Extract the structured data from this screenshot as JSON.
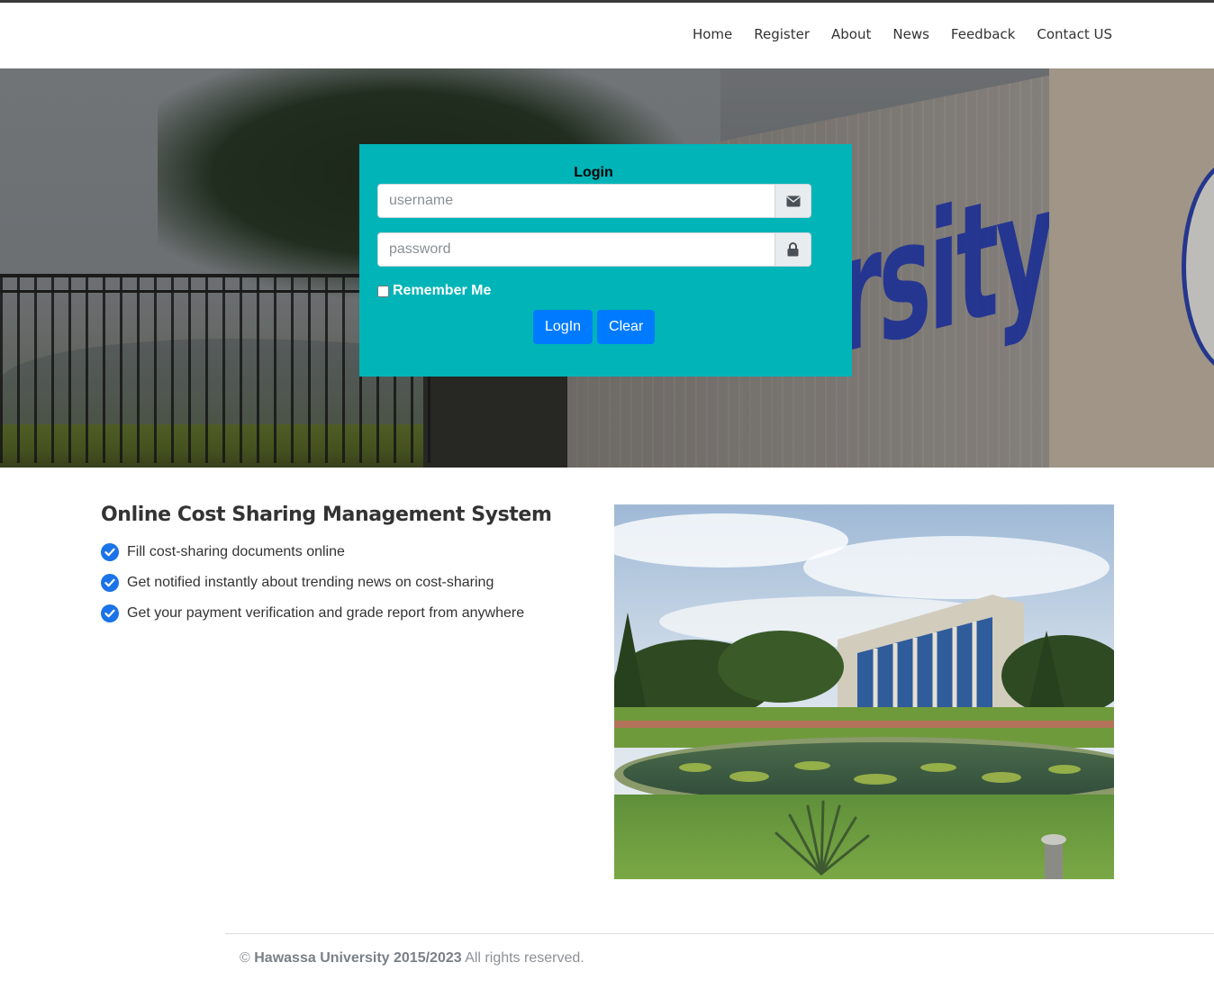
{
  "nav": {
    "items": [
      {
        "label": "Home"
      },
      {
        "label": "Register"
      },
      {
        "label": "About"
      },
      {
        "label": "News"
      },
      {
        "label": "Feedback"
      },
      {
        "label": "Contact US"
      }
    ]
  },
  "hero": {
    "sign_text": "rsity"
  },
  "login": {
    "title": "Login",
    "username_placeholder": "username",
    "username_icon": "envelope-icon",
    "password_placeholder": "password",
    "password_icon": "lock-icon",
    "remember_label": "Remember Me",
    "remember_checked": false,
    "login_button": "LogIn",
    "clear_button": "Clear",
    "panel_color": "#00b4b8",
    "button_color": "#007bff"
  },
  "main": {
    "title": "Online Cost Sharing Management System",
    "features": [
      {
        "text": "Fill cost-sharing documents online",
        "icon": "check-circle-icon"
      },
      {
        "text": "Get notified instantly about trending news on cost-sharing",
        "icon": "check-circle-icon"
      },
      {
        "text": "Get your payment verification and grade report from anywhere",
        "icon": "check-circle-icon"
      }
    ],
    "check_color": "#1a73e8"
  },
  "footer": {
    "copyright_symbol": "©",
    "owner": "Hawassa University 2015/2023",
    "rights": "All rights reserved."
  }
}
